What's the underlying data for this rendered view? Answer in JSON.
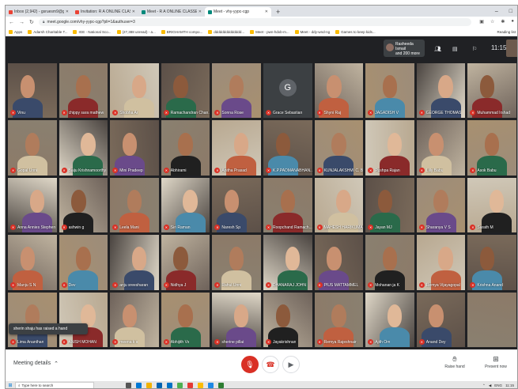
{
  "browser": {
    "tabs": [
      {
        "label": "Inbox (2,942) - gsruesm9@gm",
        "kind": "mail"
      },
      {
        "label": "Invitation: R A ONLINE CLASSES",
        "kind": "mail"
      },
      {
        "label": "Meet - R A ONLINE CLASSES V",
        "kind": "meet"
      },
      {
        "label": "Meet - vhy-yypc-cgp",
        "kind": "meet",
        "active": true
      }
    ],
    "new_tab": "+",
    "url": "meet.google.com/vhy-yypc-cgp?pli=1&authuser=3",
    "bookmarks": [
      "Apps",
      "Adarsh Charitable T...",
      "IGE - National Sco...",
      "(27,388 unread) - a...",
      "BRIGHAMTH compo...",
      "dddddddddddddd...",
      "Meet - pwn-hdxb-m...",
      "Meet - ddy-wnd-ng",
      "Games to keep kids..."
    ],
    "bookmarks_right": "Reading list"
  },
  "meet": {
    "presenter_chip": {
      "line1": "Rasheeda Ismail",
      "line2": "and 200 more"
    },
    "time": "11:15",
    "raised_hand_toast": "sherin shaju has raised a hand",
    "meeting_details": "Meeting details",
    "raise_hand": "Raise hand",
    "present_now": "Present now"
  },
  "participants": [
    [
      "Vinu",
      "chippy sara mathew",
      "Shobha Ar",
      "Ramachandran Chan...",
      "Sonna Rose",
      "Grace Sebastian",
      "Shyni Raj",
      "JAGADISH V",
      "GEORGE THOMAS",
      "Muhammad Irshad"
    ],
    [
      "Gopal Unni",
      "Baiju Krishnamoorthy",
      "Mini Pradeep",
      "Abhirami",
      "Anitha Prasad",
      "K.P.PADMANABHAN...",
      "KUNJALAKSHMI C. B",
      "Pushpa Rajan",
      "Lilly Babu",
      "Asok Babu"
    ],
    [
      "Anna Annies Stephen",
      "ashwin g",
      "Leela Mani",
      "Siri Raman",
      "Naresh Sp",
      "Roopchand Ramach...",
      "MAHESH HARIKUMAR",
      "Jayan MJ",
      "Sharanya V S",
      "Sarath M"
    ],
    [
      "Manju S N",
      "Dev",
      "anju sreesharan",
      "Nidhya J",
      "Rahul Unni",
      "DHANARAJ JOHN",
      "PIUS MATTAMMEL",
      "Mohanan ja K",
      "Remya Vijayagopal",
      "Krishna Anand"
    ],
    [
      "Lima Ananthan",
      "ANISH MOHAN",
      "meena k s",
      "Abhijith Vs",
      "sherine pillai",
      "Jayakrishnan",
      "Remya Rajeshnair",
      "Ajith Om",
      "Anand Dey",
      ""
    ]
  ],
  "taskbar": {
    "search_placeholder": "Type here to search",
    "time": "11:15",
    "lang": "ENG"
  }
}
